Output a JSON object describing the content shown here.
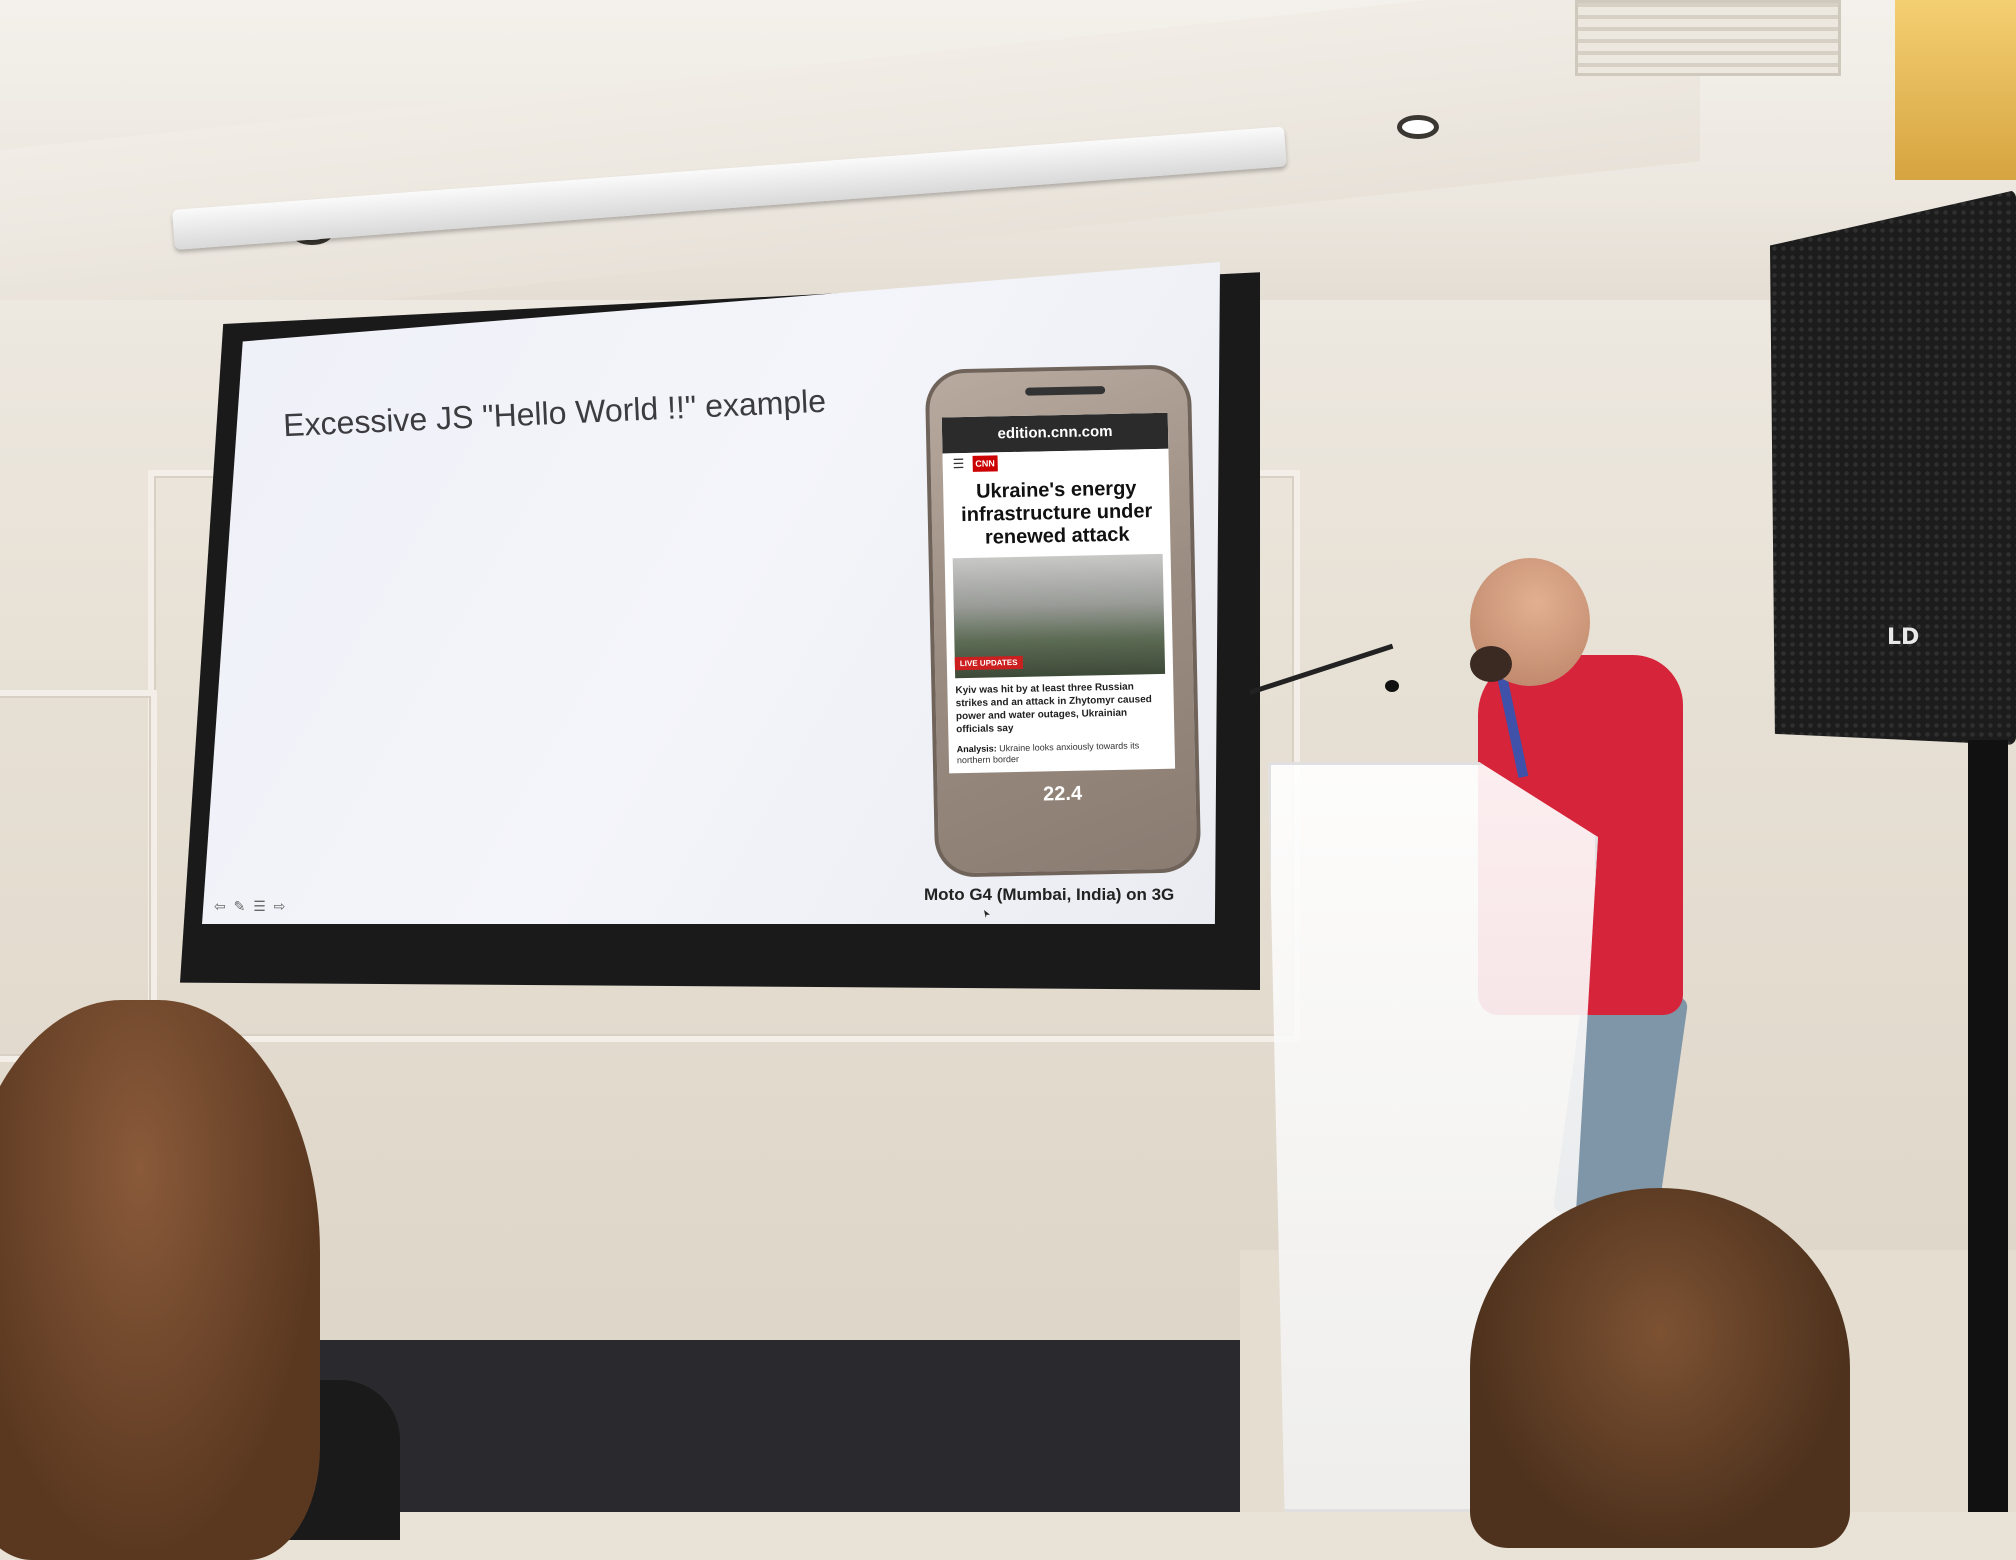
{
  "slide": {
    "title": "Excessive JS \"Hello World !!\" example",
    "caption": "Moto G4 (Mumbai, India) on 3G"
  },
  "phone": {
    "url": "edition.cnn.com",
    "brand": "CNN",
    "headline": "Ukraine's energy infrastructure under renewed attack",
    "badge": "LIVE UPDATES",
    "summary": "Kyiv was hit by at least three Russian strikes and an attack in Zhytomyr caused power and water outages, Ukrainian officials say",
    "analysis_label": "Analysis:",
    "analysis_text": "Ukraine looks anxiously towards its northern border",
    "timer": "22.4"
  },
  "loudspeaker": {
    "brand": "LD"
  },
  "colors": {
    "shirt": "#d6243a",
    "screen": "#eef0f8",
    "cnn_red": "#cc0000"
  }
}
